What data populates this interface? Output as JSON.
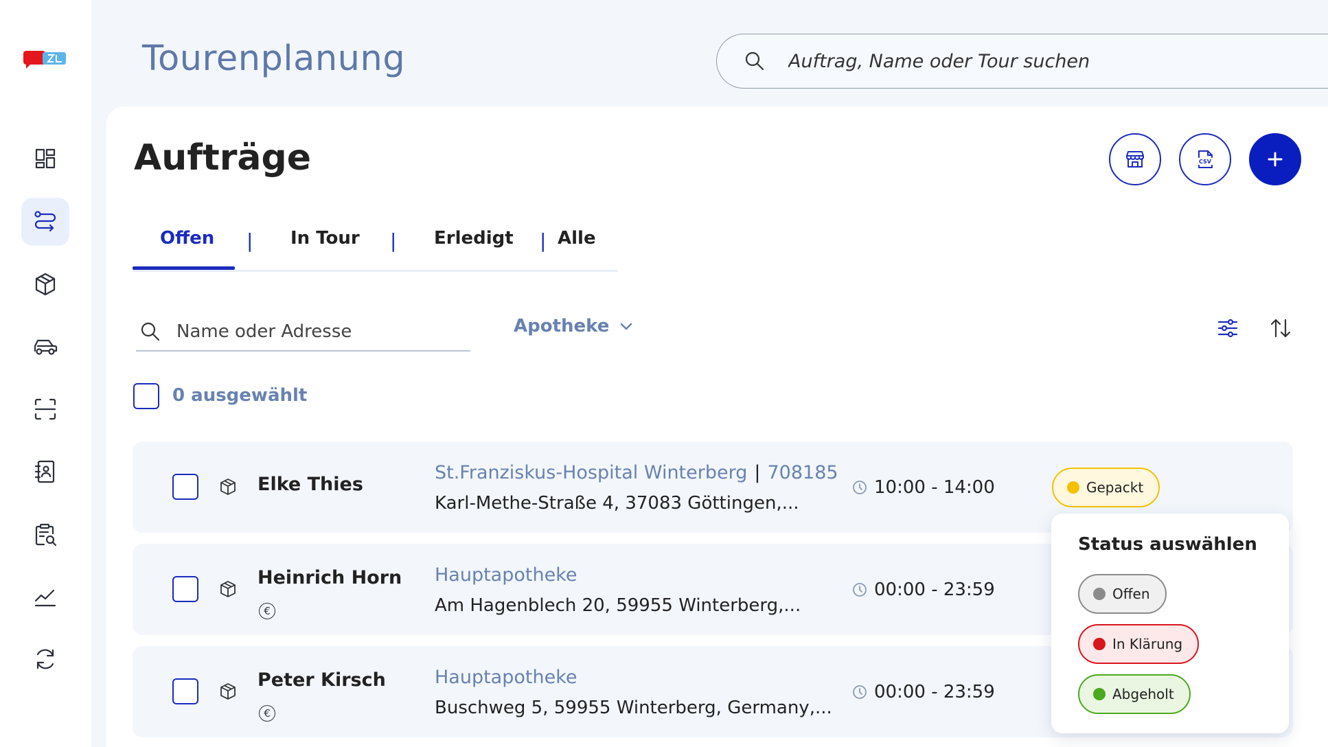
{
  "sidebar": {
    "logo_name": "brand-logo",
    "items": [
      {
        "name": "dashboard",
        "icon": "dashboard-icon",
        "active": false
      },
      {
        "name": "routes",
        "icon": "route-icon",
        "active": true
      },
      {
        "name": "packages",
        "icon": "package-icon",
        "active": false
      },
      {
        "name": "vehicles",
        "icon": "car-icon",
        "active": false
      },
      {
        "name": "scanner",
        "icon": "scan-icon",
        "active": false
      },
      {
        "name": "contacts",
        "icon": "contact-book-icon",
        "active": false
      },
      {
        "name": "reports",
        "icon": "clipboard-search-icon",
        "active": false
      },
      {
        "name": "statistics",
        "icon": "chart-icon",
        "active": false
      },
      {
        "name": "sync",
        "icon": "sync-icon",
        "active": false
      }
    ]
  },
  "header": {
    "title": "Tourenplanung",
    "search_placeholder": "Auftrag, Name oder Tour suchen"
  },
  "main": {
    "title": "Aufträge",
    "actions": {
      "store_icon": "store-icon",
      "csv_icon": "csv-file-icon",
      "add_icon": "plus-icon"
    },
    "tabs": [
      {
        "label": "Offen",
        "active": true
      },
      {
        "label": "In Tour",
        "active": false
      },
      {
        "label": "Erledigt",
        "active": false
      },
      {
        "label": "Alle",
        "active": false
      }
    ],
    "filter": {
      "search_placeholder": "Name oder Adresse",
      "dropdown_value": "Apotheke"
    },
    "selected_count": "0 ausgewählt",
    "orders": [
      {
        "name": "Elke Thies",
        "payment": "",
        "pharmacy": "St.Franziskus-Hospital Winterberg",
        "order_id": "708185",
        "address": "Karl-Methe-Straße 4, 37083 Göttingen,...",
        "time": "10:00 - 14:00",
        "status": "Gepackt"
      },
      {
        "name": "Heinrich Horn",
        "payment": "€",
        "pharmacy": "Hauptapotheke",
        "order_id": "",
        "address": "Am Hagenblech 20, 59955 Winterberg,...",
        "time": "00:00 - 23:59",
        "status": ""
      },
      {
        "name": "Peter Kirsch",
        "payment": "€",
        "pharmacy": "Hauptapotheke",
        "order_id": "",
        "address": "Buschweg 5, 59955 Winterberg, Germany,...",
        "time": "00:00 - 23:59",
        "status": ""
      }
    ]
  },
  "status_popup": {
    "title": "Status auswählen",
    "options": [
      {
        "label": "Offen",
        "color": "#8a8a8a",
        "border": "#8a8a8a",
        "bg": "#f0f0f0"
      },
      {
        "label": "In Klärung",
        "color": "#d9141b",
        "border": "#d9141b",
        "bg": "#fde9ea"
      },
      {
        "label": "Abgeholt",
        "color": "#4aa91e",
        "border": "#4aa91e",
        "bg": "#eaf6e2"
      }
    ]
  },
  "current_status": {
    "label": "Gepackt",
    "color": "#f5c000",
    "border": "#f5c000",
    "bg": "#fff8df"
  },
  "colors": {
    "accent": "#1a2bbd",
    "muted_blue": "#6882b0"
  }
}
